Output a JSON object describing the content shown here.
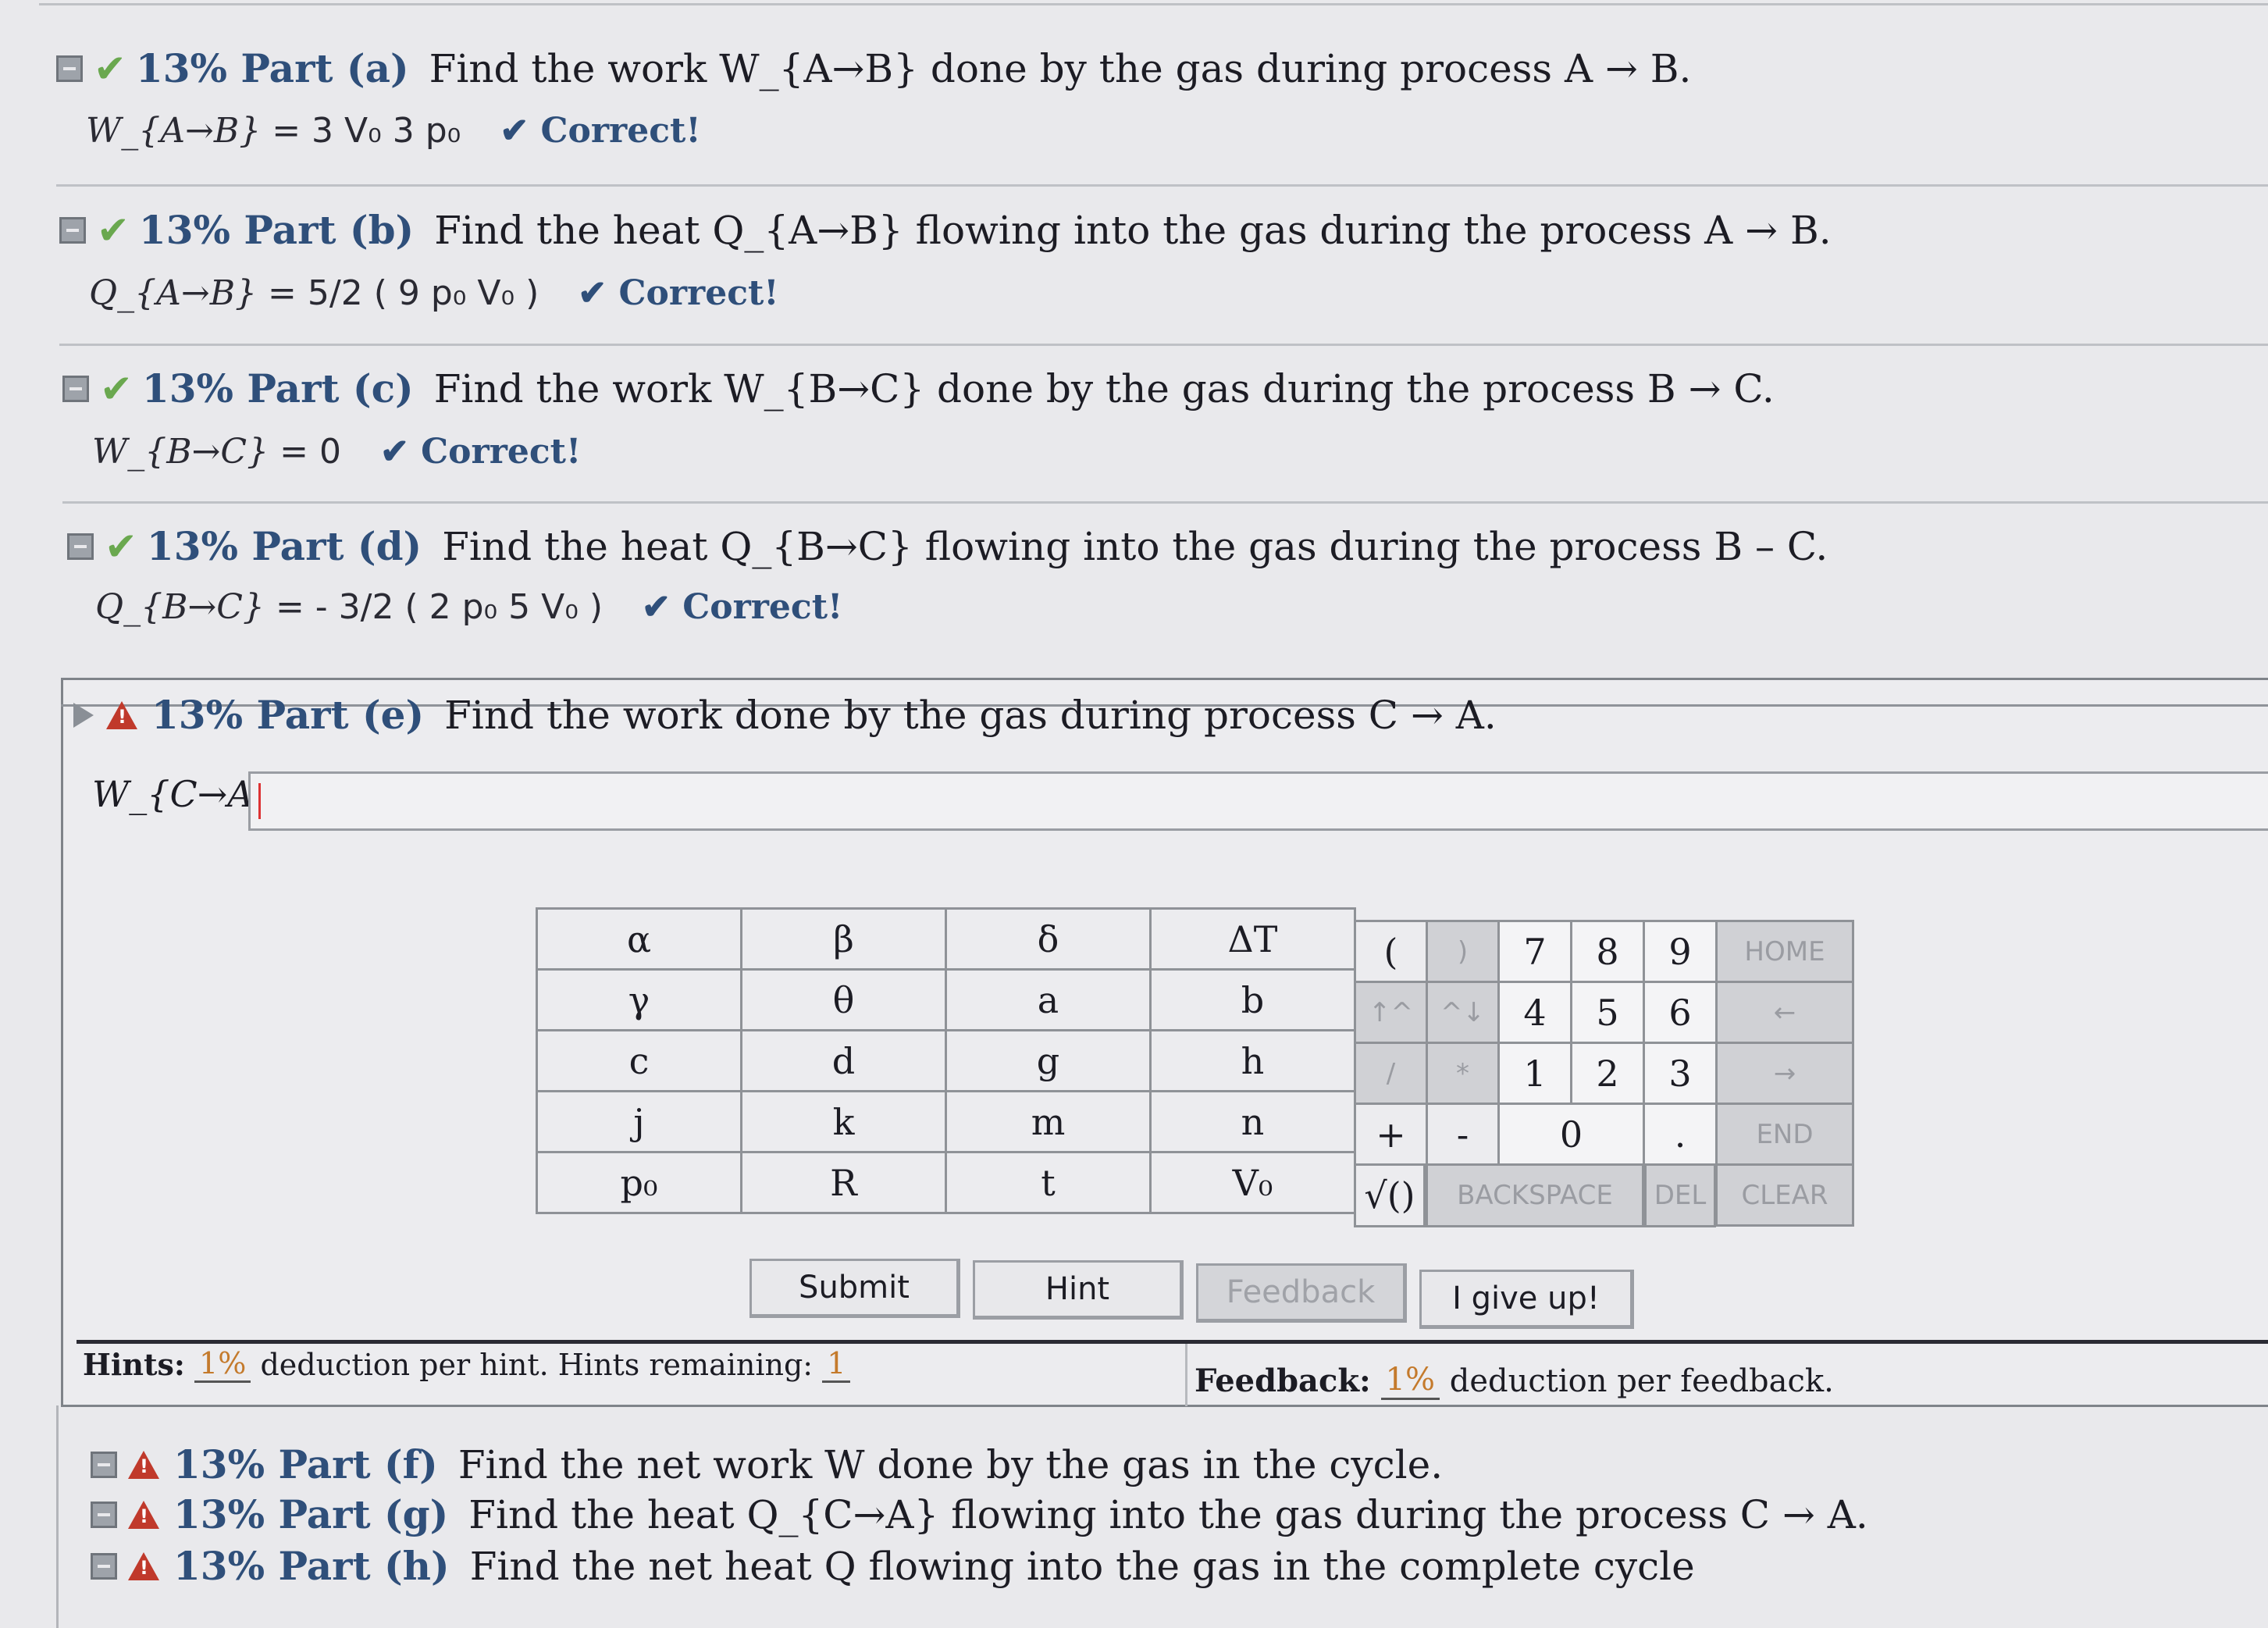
{
  "parts": [
    {
      "pct": "13%",
      "part": "Part (a)",
      "question": "Find the work W_{A→B} done by the gas during process A → B.",
      "answer_lhs": "W_{A→B}",
      "answer_rhs": "= 3 V₀ 3 p₀",
      "status": "✔ Correct!"
    },
    {
      "pct": "13%",
      "part": "Part (b)",
      "question": "Find the heat Q_{A→B} flowing into the gas during the process A → B.",
      "answer_lhs": "Q_{A→B}",
      "answer_rhs": "= 5/2 ( 9 p₀ V₀ )",
      "status": "✔ Correct!"
    },
    {
      "pct": "13%",
      "part": "Part (c)",
      "question": "Find the work W_{B→C} done by the gas during the process B → C.",
      "answer_lhs": "W_{B→C}",
      "answer_rhs": "= 0",
      "status": "✔ Correct!"
    },
    {
      "pct": "13%",
      "part": "Part (d)",
      "question": "Find the heat Q_{B→C} flowing into the gas during the process B – C.",
      "answer_lhs": "Q_{B→C}",
      "answer_rhs": "= - 3/2 ( 2 p₀ 5 V₀ )",
      "status": "✔ Correct!"
    }
  ],
  "active_part": {
    "pct": "13%",
    "part": "Part (e)",
    "question": "Find the work done by the gas during process C → A.",
    "input_label": "W_{C→A} =",
    "input_value": ""
  },
  "keypad": {
    "symbols": [
      [
        "α",
        "β",
        "δ",
        "ΔT"
      ],
      [
        "γ",
        "θ",
        "a",
        "b"
      ],
      [
        "c",
        "d",
        "g",
        "h"
      ],
      [
        "j",
        "k",
        "m",
        "n"
      ],
      [
        "p₀",
        "R",
        "t",
        "V₀"
      ]
    ],
    "ops": [
      [
        "(",
        ")"
      ],
      [
        "↑^",
        "^↓"
      ],
      [
        "/",
        "*"
      ],
      [
        "+",
        "-"
      ]
    ],
    "digits": [
      [
        "7",
        "8",
        "9"
      ],
      [
        "4",
        "5",
        "6"
      ],
      [
        "1",
        "2",
        "3"
      ]
    ],
    "zero": "0",
    "dot": ".",
    "side": [
      "HOME",
      "←",
      "→",
      "END",
      "CLEAR"
    ],
    "sqrt": "√()",
    "backspace": "BACKSPACE",
    "del": "DEL"
  },
  "buttons": {
    "submit": "Submit",
    "hint": "Hint",
    "feedback": "Feedback",
    "giveup": "I give up!"
  },
  "hints": {
    "label": "Hints:",
    "pct": "1%",
    "text": "deduction per hint. Hints remaining:",
    "remaining": "1"
  },
  "feedback": {
    "label": "Feedback:",
    "pct": "1%",
    "text": "deduction per feedback."
  },
  "locked_parts": [
    {
      "pct": "13%",
      "part": "Part (f)",
      "question": "Find the net work W done by the gas in the cycle."
    },
    {
      "pct": "13%",
      "part": "Part (g)",
      "question": "Find the heat Q_{C→A} flowing into the gas during the process C → A."
    },
    {
      "pct": "13%",
      "part": "Part (h)",
      "question": "Find the net heat Q flowing into the gas in the complete cycle"
    }
  ],
  "colors": {
    "accent": "#2f4f7a",
    "check": "#6aa84f",
    "warning": "#c0392b",
    "deduction": "#c47a2c"
  }
}
